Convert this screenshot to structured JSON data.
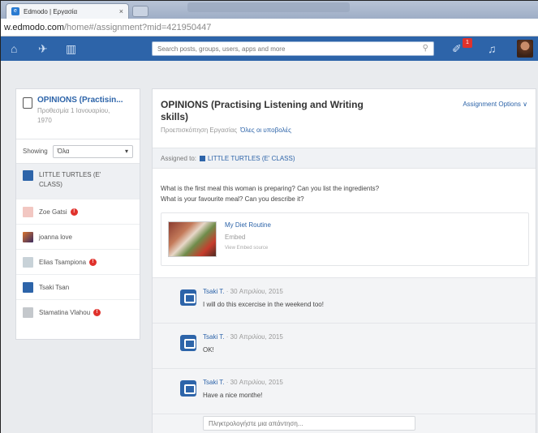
{
  "browser": {
    "tab_title": "Edmodo | Εργασία",
    "tab_close": "×",
    "url_host": "w.edmodo.com",
    "url_path": "/home#/assignment?mid=421950447"
  },
  "nav": {
    "search_placeholder": "Search posts, groups, users, apps and more",
    "notification_count": "1"
  },
  "sidebar": {
    "assignment_title": "OPINIONS (Practisin...",
    "due_line1": "Προθεσμία 1 Ιανουαρίου,",
    "due_line2": "1970",
    "showing_label": "Showing",
    "showing_value": "Όλα",
    "items": [
      {
        "label": "LITTLE TURTLES (E'",
        "label2": "CLASS)",
        "color": "#2d64a9",
        "warn": false
      },
      {
        "label": "Zoe Gatsi",
        "color": "#f2c7c2",
        "warn": true
      },
      {
        "label": "joanna love",
        "color": "#8a4a2a",
        "warn": false
      },
      {
        "label": "Elias Tsampiona",
        "color": "#c8d2d8",
        "warn": true
      },
      {
        "label": "Tsaki Tsan",
        "color": "#2d64a9",
        "warn": false
      },
      {
        "label": "Stamatina Vlahou",
        "color": "#c4c8cc",
        "warn": true
      }
    ]
  },
  "main": {
    "title": "OPINIONS (Practising Listening and Writing skills)",
    "subtitle": "Προεπισκόπηση Εργασίας",
    "subtitle_link": "Όλες οι υποβολές",
    "options": "Assignment Options ∨",
    "assigned_label": "Assigned to:",
    "assigned_group": "LITTLE TURTLES (E' CLASS)",
    "question_line1": "What is the first meal this woman is preparing? Can you list the ingredients?",
    "question_line2": "What is your favourite meal? Can you describe it?",
    "embed_title": "My Diet Routine",
    "embed_type": "Embed",
    "embed_source": "View Embed source",
    "comments": [
      {
        "author": "Tsaki T.",
        "date": "· 30 Απριλίου, 2015",
        "text": "I will do this excercise in the weekend too!"
      },
      {
        "author": "Tsaki T.",
        "date": "· 30 Απριλίου, 2015",
        "text": "OK!"
      },
      {
        "author": "Tsaki T.",
        "date": "· 30 Απριλίου, 2015",
        "text": "Have a nice monthe!"
      }
    ],
    "reply_placeholder": "Πληκτρολογήστε μια απάντηση..."
  }
}
